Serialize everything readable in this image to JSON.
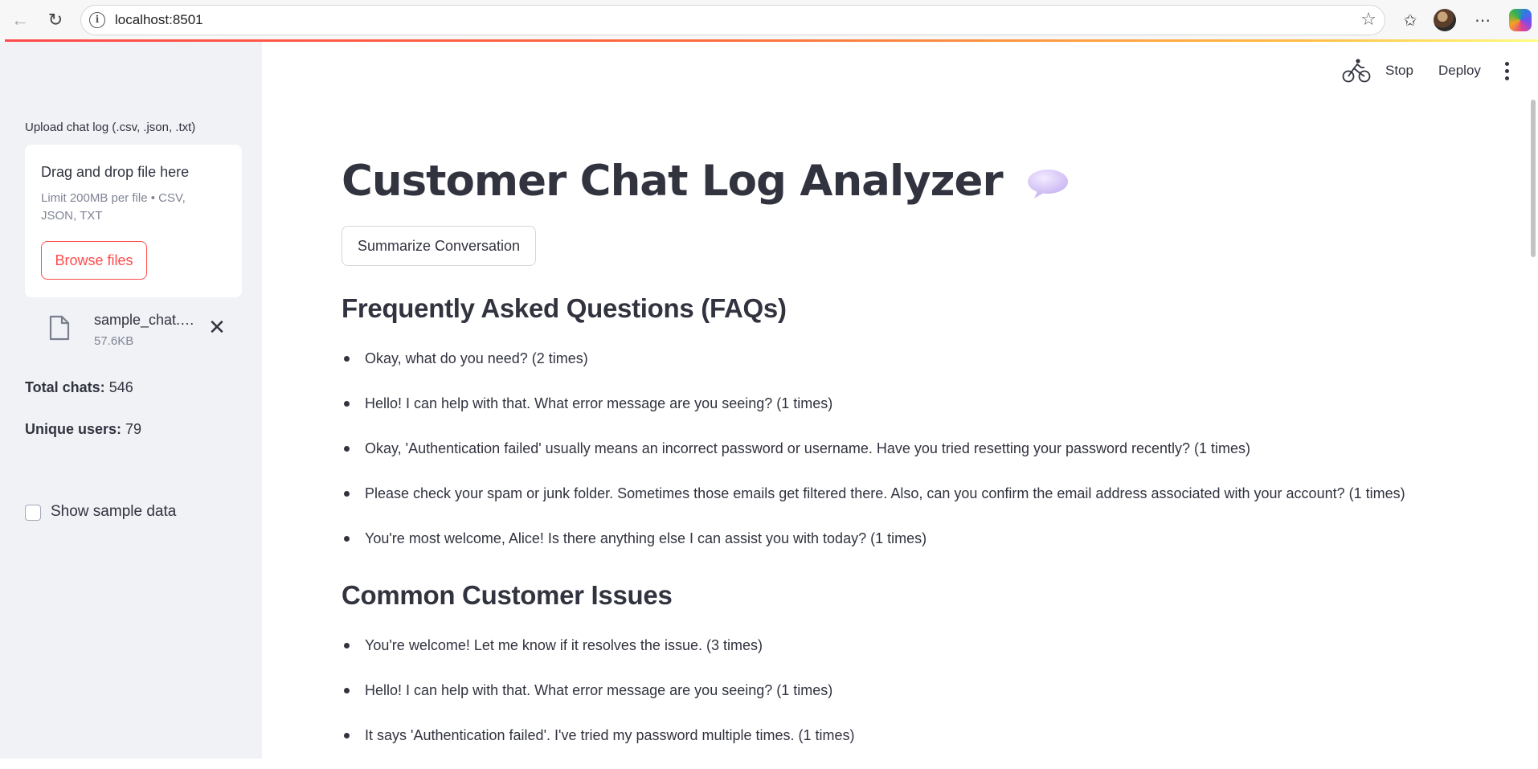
{
  "browser": {
    "url": "localhost:8501",
    "icons": [
      "back-arrow-icon",
      "reload-icon",
      "site-info-icon",
      "star-icon",
      "favorites-icon",
      "profile-avatar",
      "more-icon",
      "copilot-icon"
    ]
  },
  "toolbar": {
    "stop_label": "Stop",
    "deploy_label": "Deploy"
  },
  "sidebar": {
    "upload_label": "Upload chat log (.csv, .json, .txt)",
    "dropzone_title": "Drag and drop file here",
    "dropzone_limit": "Limit 200MB per file • CSV, JSON, TXT",
    "browse_label": "Browse files",
    "file": {
      "name": "sample_chat.…",
      "size": "57.6KB"
    },
    "stats": [
      {
        "label": "Total chats:",
        "value": "546"
      },
      {
        "label": "Unique users:",
        "value": "79"
      }
    ],
    "show_sample_label": "Show sample data",
    "show_sample_checked": false
  },
  "main": {
    "title": "Customer Chat Log Analyzer",
    "summarize_label": "Summarize Conversation",
    "faq_heading": "Frequently Asked Questions (FAQs)",
    "faqs": [
      "Okay, what do you need? (2 times)",
      "Hello! I can help with that. What error message are you seeing? (1 times)",
      "Okay, 'Authentication failed' usually means an incorrect password or username. Have you tried resetting your password recently? (1 times)",
      "Please check your spam or junk folder. Sometimes those emails get filtered there. Also, can you confirm the email address associated with your account? (1 times)",
      "You're most welcome, Alice! Is there anything else I can assist you with today? (1 times)"
    ],
    "issues_heading": "Common Customer Issues",
    "issues": [
      "You're welcome! Let me know if it resolves the issue. (3 times)",
      "Hello! I can help with that. What error message are you seeing? (1 times)",
      "It says 'Authentication failed'. I've tried my password multiple times. (1 times)"
    ]
  },
  "colors": {
    "accent": "#ff4b4b",
    "sidebar_bg": "#f0f2f6",
    "text": "#31333f"
  }
}
